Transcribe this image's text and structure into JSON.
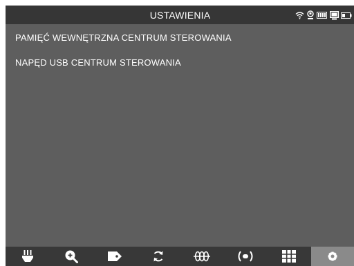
{
  "header": {
    "title": "USTAWIENIA",
    "status_icons": [
      "wifi-icon",
      "temperature-icon",
      "battery-icon",
      "monitor-icon",
      "device-battery-icon"
    ]
  },
  "menu": {
    "items": [
      {
        "label": "PAMIĘĆ WEWNĘTRZNA CENTRUM STEROWANIA"
      },
      {
        "label": "NAPĘD USB CENTRUM STEROWANIA"
      }
    ]
  },
  "toolbar": {
    "buttons": [
      {
        "icon": "camera-head-icon",
        "active": false
      },
      {
        "icon": "zoom-in-icon",
        "active": false
      },
      {
        "icon": "tag-icon",
        "active": false
      },
      {
        "icon": "rotate-icon",
        "active": false
      },
      {
        "icon": "sonde-icon",
        "active": false
      },
      {
        "icon": "transmitter-icon",
        "active": false
      },
      {
        "icon": "grid-icon",
        "active": false
      },
      {
        "icon": "settings-gear-icon",
        "active": true
      }
    ]
  },
  "colors": {
    "background": "#5e5e5e",
    "titlebar": "#363636",
    "toolbar": "#383838",
    "active_tool": "#8a8a8a",
    "text": "#ffffff"
  }
}
